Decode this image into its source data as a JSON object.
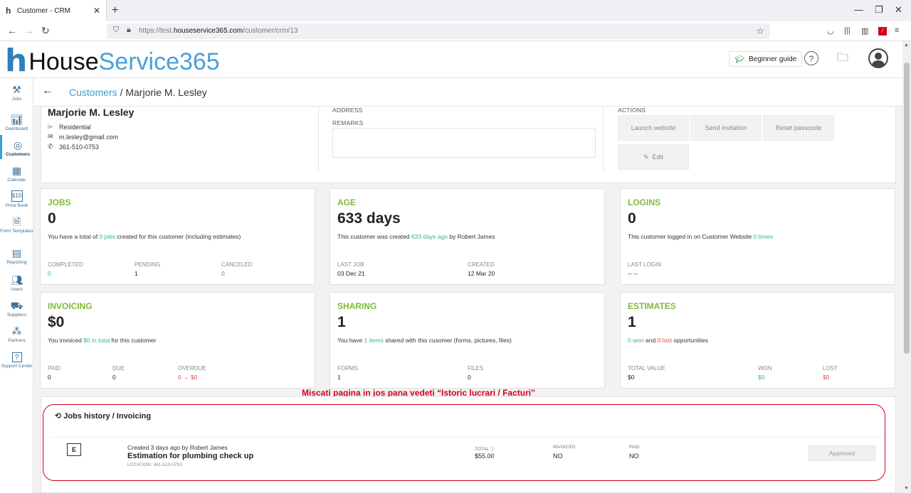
{
  "browser": {
    "tab_title": "Customer - CRM",
    "url_prefix": "https://test.",
    "url_domain": "houseservice365.com",
    "url_path": "/customer/crm/13"
  },
  "header": {
    "logo_house": "House",
    "logo_service": "Service365",
    "guide_label": "Beginner guide"
  },
  "sidebar": {
    "items": [
      {
        "label": "Jobs",
        "icon": "tools-icon"
      },
      {
        "label": "Dashboard",
        "icon": "bar-chart-icon"
      },
      {
        "label": "Customers",
        "icon": "target-icon"
      },
      {
        "label": "Calendar",
        "icon": "calendar-icon"
      },
      {
        "label": "Price Book",
        "icon": "price-tag-icon"
      },
      {
        "label": "Form Templates",
        "icon": "form-icon"
      },
      {
        "label": "Reporting",
        "icon": "report-icon"
      },
      {
        "label": "Users",
        "icon": "users-icon"
      },
      {
        "label": "Suppliers",
        "icon": "truck-icon"
      },
      {
        "label": "Partners",
        "icon": "network-icon"
      },
      {
        "label": "Support Center",
        "icon": "help-icon"
      }
    ]
  },
  "breadcrumb": {
    "parent": "Customers",
    "separator": " / ",
    "current": "Marjorie M. Lesley"
  },
  "profile": {
    "name": "Marjorie M. Lesley",
    "type": "Residential",
    "email": "m.lesley@gmail.com",
    "phone": "361-510-0753",
    "address_label": "ADDRESS",
    "remarks_label": "REMARKS",
    "actions_label": "ACTIONS",
    "actions": {
      "launch": "Launch website",
      "invite": "Send invitation",
      "reset": "Reset passcode",
      "edit": "Edit"
    }
  },
  "cards": {
    "jobs": {
      "title": "JOBS",
      "value": "0",
      "desc_pre": "You have a total of ",
      "desc_link": "0 jobs",
      "desc_post": " created for this customer (including estimates)",
      "s1_label": "COMPLETED",
      "s1_value": "0",
      "s2_label": "PENDING",
      "s2_value": "1",
      "s3_label": "CANCELED",
      "s3_value": "0"
    },
    "age": {
      "title": "AGE",
      "value": "633 days",
      "desc_pre": "This customer was created ",
      "desc_link": "633 days ago",
      "desc_post": " by Robert James",
      "s1_label": "LAST JOB",
      "s1_value": "03 Dec 21",
      "s2_label": "CREATED",
      "s2_value": "12 Mar 20"
    },
    "logins": {
      "title": "LOGINS",
      "value": "0",
      "desc_pre": "This customer logged in on Customer Website ",
      "desc_link": "0 times",
      "desc_post": "",
      "s1_label": "LAST LOGIN",
      "s1_value": "-- --"
    },
    "invoicing": {
      "title": "INVOICING",
      "value": "$0",
      "desc_pre": "You invoiced ",
      "desc_link": "$0 in total",
      "desc_post": " for this customer",
      "s1_label": "PAID",
      "s1_value": "0",
      "s2_label": "DUE",
      "s2_value": "0",
      "s3_label": "OVERDUE",
      "s3_value": "0 → $0"
    },
    "sharing": {
      "title": "SHARING",
      "value": "1",
      "desc_pre": "You have ",
      "desc_link": "1 items",
      "desc_post": " shared with this cusomer (forms, pictures, files)",
      "s1_label": "FORMS",
      "s1_value": "1",
      "s2_label": "FILES",
      "s2_value": "0"
    },
    "estimates": {
      "title": "ESTIMATES",
      "value": "1",
      "desc_link": "0 won",
      "desc_mid": " and ",
      "desc_link2": "0 lost",
      "desc_post": " opportunities",
      "s1_label": "TOTAL VALUE",
      "s1_value": "$0",
      "s2_label": "WON",
      "s2_value": "$0",
      "s3_label": "LOST",
      "s3_value": "$0"
    }
  },
  "annotation": "Miscati pagina in jos pana vedeti “Istoric lucrari / Facturi”",
  "history": {
    "title": "Jobs history / Invoicing",
    "row": {
      "badge": "E",
      "created": "Created 3 days ago by Robert James",
      "job": "Estimation for plumbing check up",
      "location": "LOCATION: 361-510-0753",
      "total_label": "TOTAL ⓘ",
      "total_value": "$55.00",
      "invoiced_label": "INVOICED",
      "invoiced_value": "NO",
      "paid_label": "PAID",
      "paid_value": "NO",
      "status": "Approved"
    }
  }
}
